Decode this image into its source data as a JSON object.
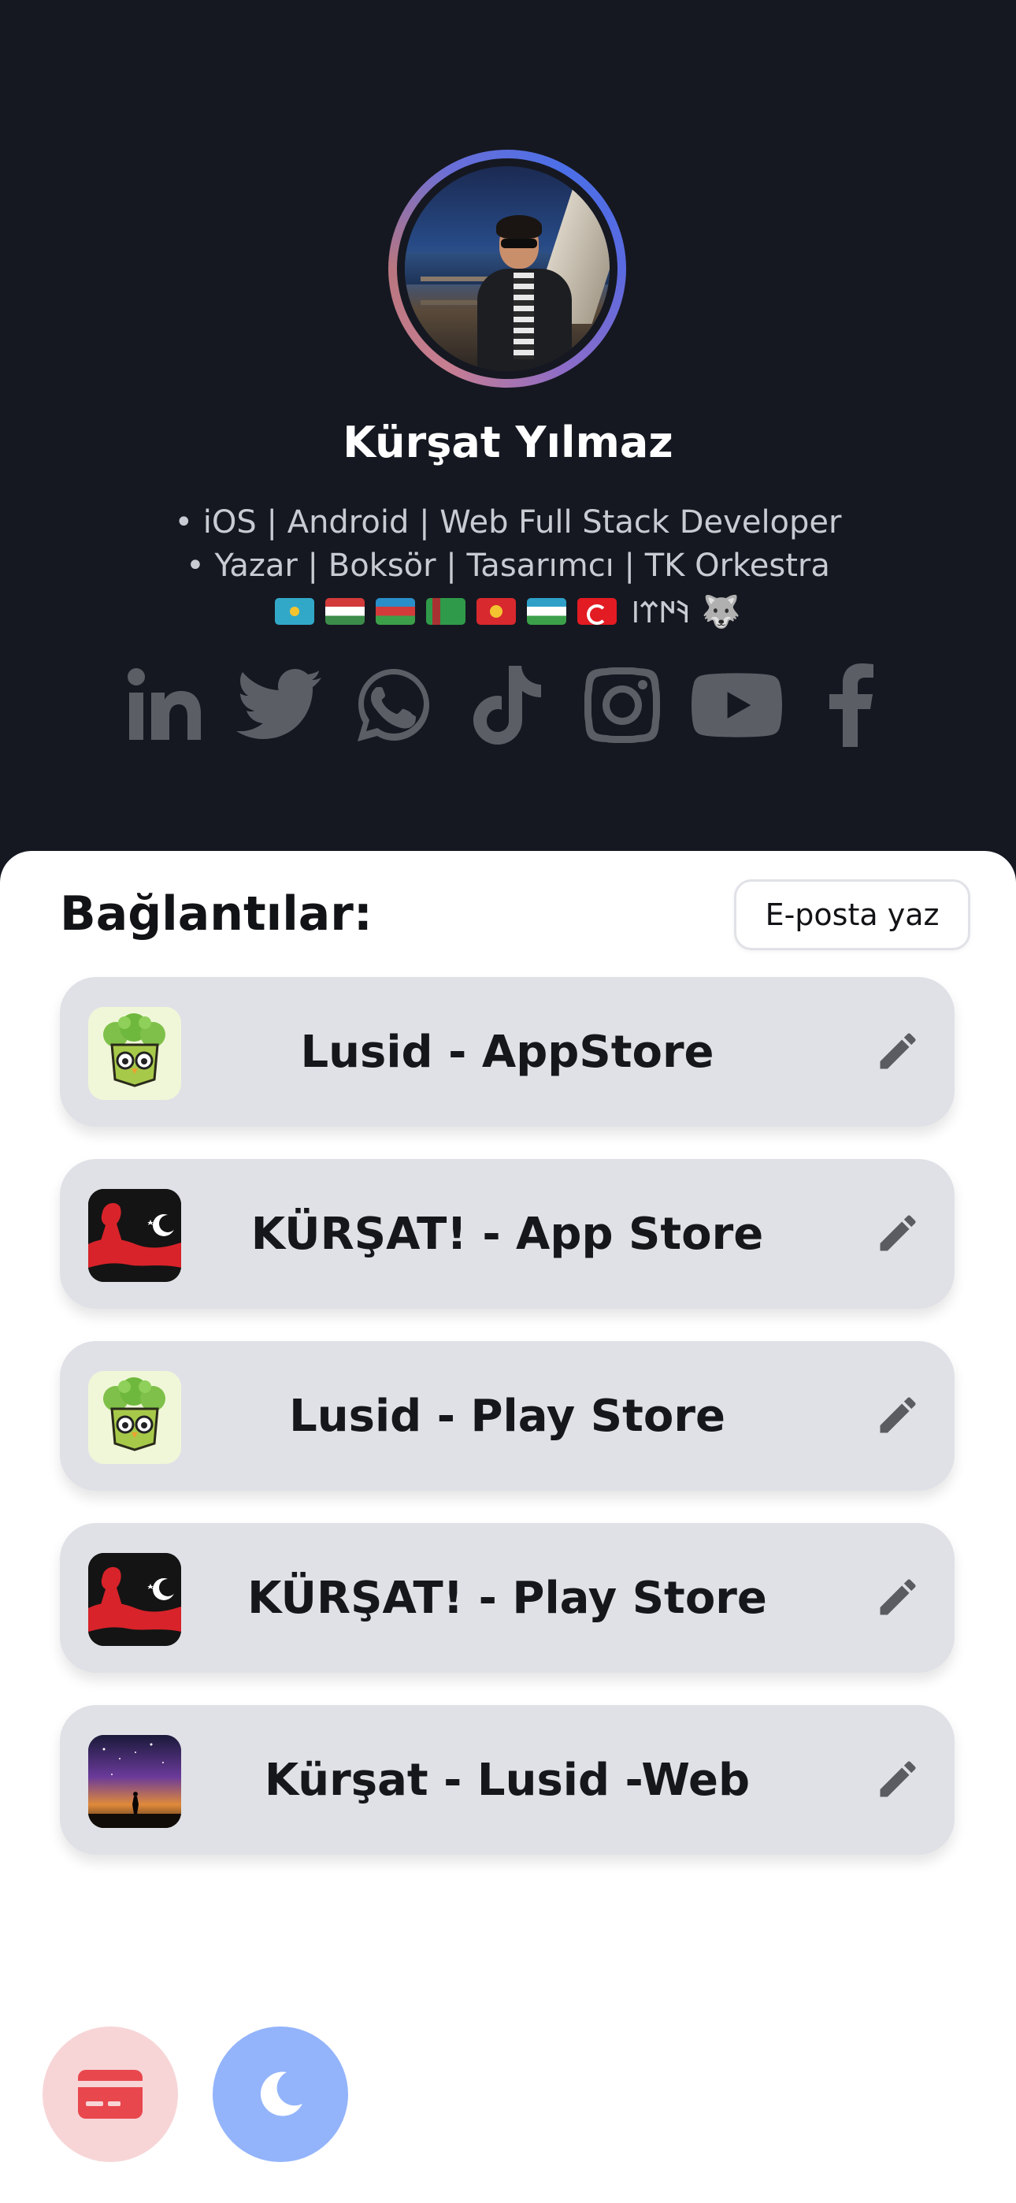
{
  "profile": {
    "name": "Kürşat Yılmaz",
    "bio_line_1": "• iOS | Android | Web Full Stack Developer",
    "bio_line_2": "• Yazar | Boksör | Tasarımcı | TK Orkestra",
    "bio_line_3_flags": [
      "kazakhstan-flag",
      "hungary-flag",
      "azerbaijan-flag",
      "turkmenistan-flag",
      "kyrgyzstan-flag",
      "uzbekistan-flag",
      "turkey-flag"
    ],
    "bio_line_3_script": "𐰚𐰇𐰼𐰾",
    "bio_line_3_emoji": "🐺"
  },
  "social_icons": [
    "linkedin-icon",
    "twitter-icon",
    "whatsapp-icon",
    "tiktok-icon",
    "instagram-icon",
    "youtube-icon",
    "facebook-icon"
  ],
  "links_section": {
    "title": "Bağlantılar:",
    "email_button_label": "E-posta yaz",
    "items": [
      {
        "label": "Lusid - AppStore",
        "thumb": "owl"
      },
      {
        "label": "KÜRŞAT! - App Store",
        "thumb": "turkey"
      },
      {
        "label": "Lusid - Play Store",
        "thumb": "owl"
      },
      {
        "label": "KÜRŞAT! - Play Store",
        "thumb": "turkey"
      },
      {
        "label": "Kürşat - Lusid -Web",
        "thumb": "night-sky"
      }
    ]
  },
  "fabs": [
    "card-icon",
    "moon-icon"
  ],
  "colors": {
    "header_bg": "#151821",
    "link_bg": "#dfe1e6",
    "fab_card_bg": "#f7d5d6",
    "fab_moon_bg": "#93b4fb",
    "icon_gray": "#5c5e66"
  }
}
